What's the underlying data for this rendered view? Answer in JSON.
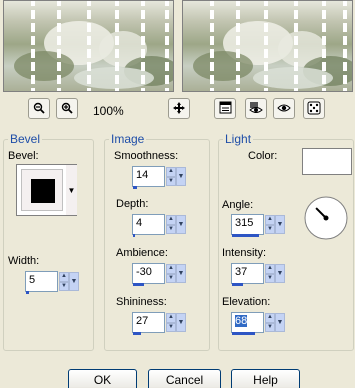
{
  "toolbar": {
    "zoom_out_icon": "magnifier-minus",
    "zoom_in_icon": "magnifier-plus",
    "zoom_level": "100%",
    "pan_icon": "four-way-arrow",
    "proof_icon": "preview-window",
    "hide_original_icon": "eye-with-image",
    "show_icon": "eye",
    "randomize_icon": "dice"
  },
  "bevel": {
    "legend": "Bevel",
    "bevel_label": "Bevel:",
    "width_label": "Width:",
    "width_value": "5",
    "width_fraction": 0.1
  },
  "image": {
    "legend": "Image",
    "smoothness_label": "Smoothness:",
    "smoothness_value": "14",
    "smoothness_fraction": 0.14,
    "depth_label": "Depth:",
    "depth_value": "4",
    "depth_fraction": 0.08,
    "ambience_label": "Ambience:",
    "ambience_value": "-30",
    "ambience_fraction": 0.35,
    "shininess_label": "Shininess:",
    "shininess_value": "27",
    "shininess_fraction": 0.27
  },
  "light": {
    "legend": "Light",
    "color_label": "Color:",
    "color_value": "#ffffff",
    "angle_label": "Angle:",
    "angle_value": "315",
    "angle_fraction": 0.87,
    "intensity_label": "Intensity:",
    "intensity_value": "37",
    "intensity_fraction": 0.37,
    "elevation_label": "Elevation:",
    "elevation_value": "68",
    "elevation_fraction": 0.75
  },
  "buttons": {
    "ok": "OK",
    "cancel": "Cancel",
    "help": "Help"
  },
  "colors": {
    "accent": "#1f4ea8",
    "slider_fill": "#2d55c4",
    "dialog_bg": "#ece9d8"
  }
}
